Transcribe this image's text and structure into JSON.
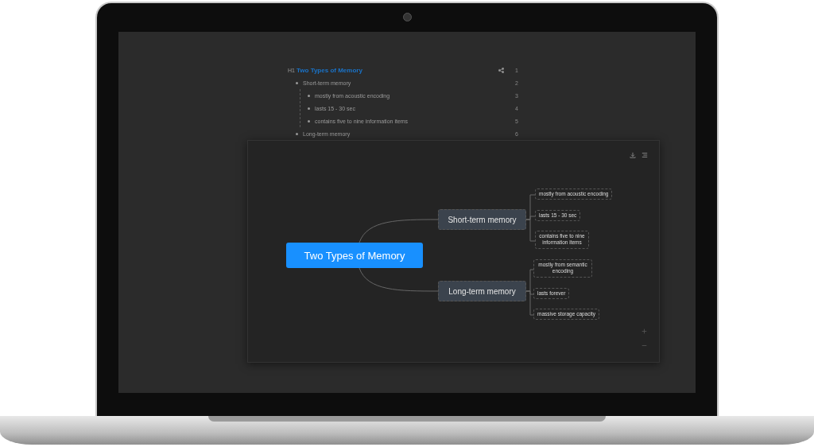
{
  "outline": {
    "heading": {
      "marker": "H1",
      "text": "Two Types of Memory",
      "line": "1"
    },
    "items": [
      {
        "text": "Short-term memory",
        "line": "2",
        "children": [
          {
            "text": "mostly from acoustic encoding",
            "line": "3"
          },
          {
            "text": "lasts 15 - 30 sec",
            "line": "4"
          },
          {
            "text": "contains five to nine information items",
            "line": "5"
          }
        ]
      },
      {
        "text": "Long-term memory",
        "line": "6"
      }
    ]
  },
  "mindmap": {
    "root": "Two Types of Memory",
    "branches": [
      {
        "text": "Short-term memory",
        "children": [
          "mostly from acoustic encoding",
          "lasts 15 - 30 sec",
          "contains five to nine information items"
        ]
      },
      {
        "text": "Long-term memory",
        "children": [
          "mostly from semantic encoding",
          "lasts forever",
          "massive storage capacity"
        ]
      }
    ]
  }
}
